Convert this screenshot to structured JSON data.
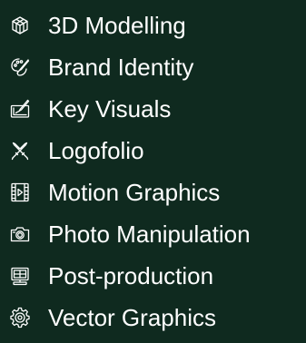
{
  "menu": {
    "items": [
      {
        "label": "3D Modelling",
        "icon": "cube-icon"
      },
      {
        "label": "Brand Identity",
        "icon": "palette-icon"
      },
      {
        "label": "Key Visuals",
        "icon": "drawing-tablet-icon"
      },
      {
        "label": "Logofolio",
        "icon": "compass-icon"
      },
      {
        "label": "Motion Graphics",
        "icon": "film-play-icon"
      },
      {
        "label": "Photo Manipulation",
        "icon": "camera-icon"
      },
      {
        "label": "Post-production",
        "icon": "monitor-icon"
      },
      {
        "label": "Vector Graphics",
        "icon": "gear-icon"
      }
    ]
  },
  "colors": {
    "background": "#0f2a1f",
    "text": "#ffffff"
  }
}
